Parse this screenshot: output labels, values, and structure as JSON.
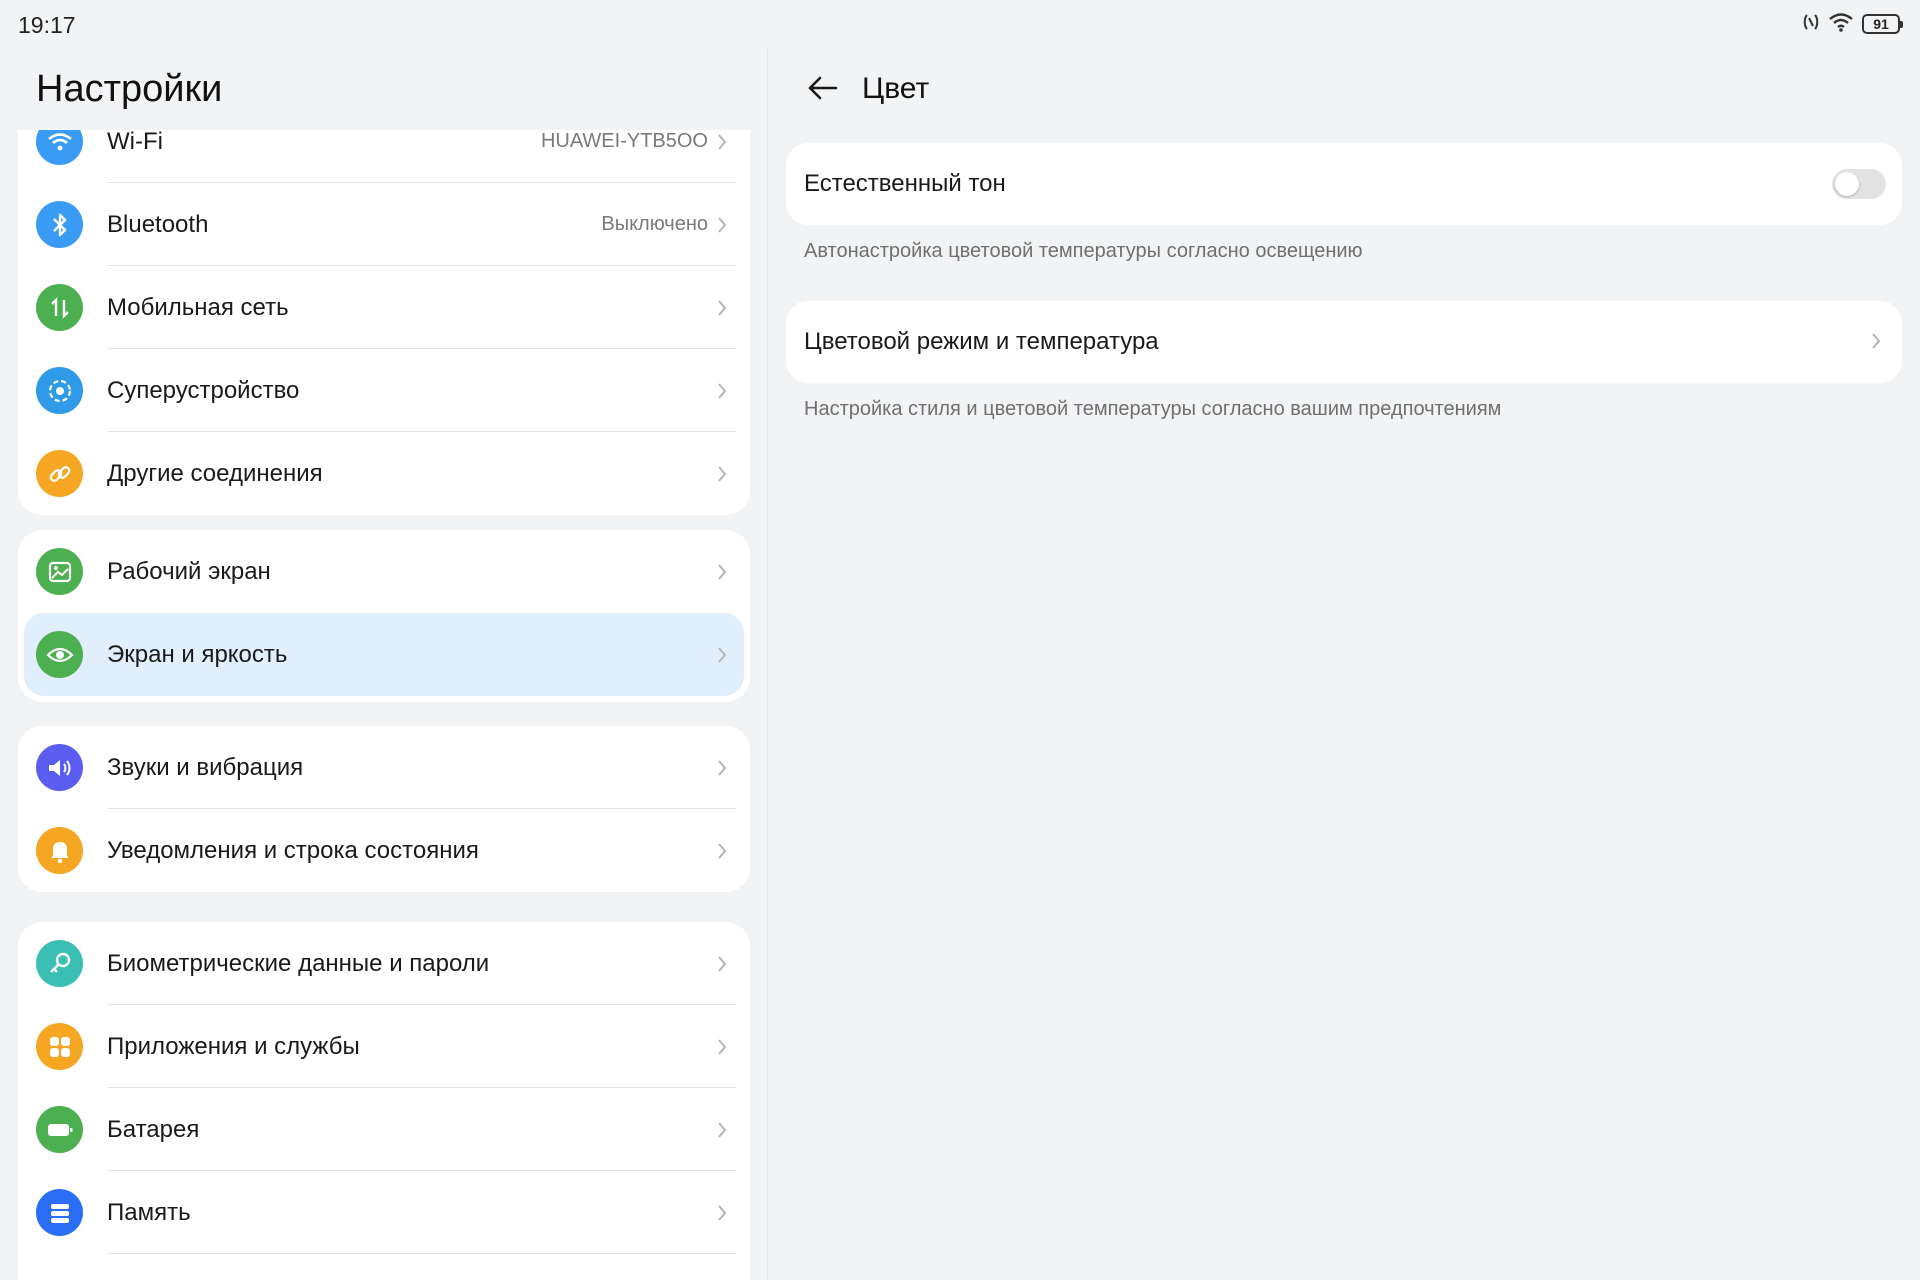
{
  "status_bar": {
    "time": "19:17",
    "battery": "91",
    "icons": [
      "nfc-icon",
      "wifi-icon",
      "battery-icon"
    ]
  },
  "left": {
    "title": "Настройки",
    "groups": [
      {
        "items": [
          {
            "label": "Wi-Fi",
            "value": "HUAWEI-YTB5OO",
            "icon": "wifi-icon",
            "color": "#3a9bf5"
          },
          {
            "label": "Bluetooth",
            "value": "Выключено",
            "icon": "bluetooth-icon",
            "color": "#3a9bf5"
          },
          {
            "label": "Мобильная сеть",
            "value": "",
            "icon": "mobile-data-icon",
            "color": "#4caf50"
          },
          {
            "label": "Суперустройство",
            "value": "",
            "icon": "super-device-icon",
            "color": "#2f9be8"
          },
          {
            "label": "Другие соединения",
            "value": "",
            "icon": "link-icon",
            "color": "#f5a623"
          }
        ]
      },
      {
        "items": [
          {
            "label": "Рабочий экран",
            "value": "",
            "icon": "wallpaper-icon",
            "color": "#4caf50"
          },
          {
            "label": "Экран и яркость",
            "value": "",
            "icon": "eye-icon",
            "color": "#4caf50",
            "selected": true
          }
        ]
      },
      {
        "items": [
          {
            "label": "Звуки и вибрация",
            "value": "",
            "icon": "speaker-icon",
            "color": "#5b5cf0"
          },
          {
            "label": "Уведомления и строка состояния",
            "value": "",
            "icon": "bell-icon",
            "color": "#f5a623"
          }
        ]
      },
      {
        "items": [
          {
            "label": "Биометрические данные и пароли",
            "value": "",
            "icon": "key-icon",
            "color": "#3bbfb5"
          },
          {
            "label": "Приложения и службы",
            "value": "",
            "icon": "apps-icon",
            "color": "#f5a623"
          },
          {
            "label": "Батарея",
            "value": "",
            "icon": "battery-icon",
            "color": "#4caf50"
          },
          {
            "label": "Память",
            "value": "",
            "icon": "storage-icon",
            "color": "#2a6ef5"
          }
        ]
      }
    ]
  },
  "right": {
    "title": "Цвет",
    "natural_tone": {
      "label": "Естественный тон",
      "hint": "Автонастройка цветовой температуры согласно освещению",
      "enabled": false
    },
    "color_mode": {
      "label": "Цветовой режим и температура",
      "hint": "Настройка стиля и цветовой температуры согласно вашим предпочтениям"
    }
  },
  "colors": {
    "background": "#f1f3f5",
    "card": "#ffffff",
    "selected_row": "#e1eefc",
    "toggle_off": "#e3e3e3"
  }
}
